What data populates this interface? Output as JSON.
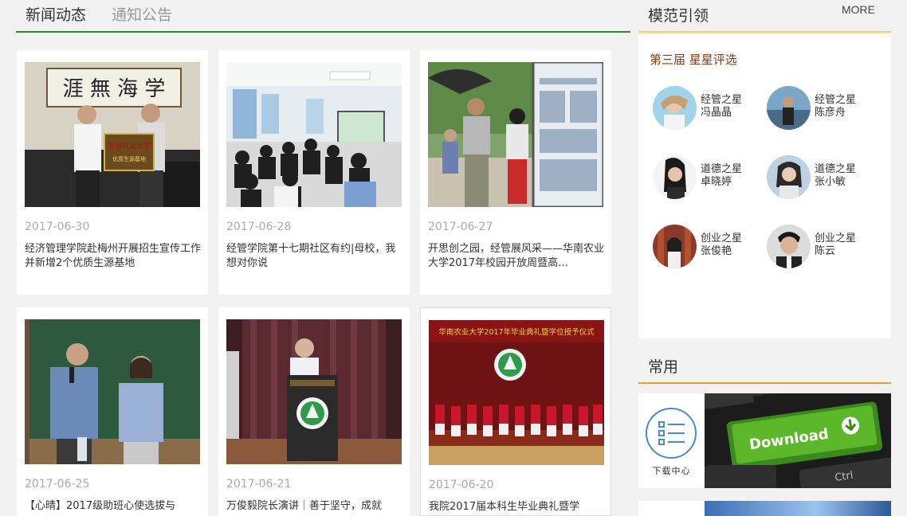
{
  "tabs": [
    {
      "label": "新闻动态"
    },
    {
      "label": "通知公告"
    }
  ],
  "news": [
    {
      "date": "2017-06-30",
      "title": "经济管理学院赴梅州开展招生宣传工作并新增2个优质生源基地"
    },
    {
      "date": "2017-06-28",
      "title": "经管学院第十七期社区有约|母校，我想对你说"
    },
    {
      "date": "2017-06-27",
      "title": "开思创之园，经管展风采——华南农业大学2017年校园开放周暨高…"
    },
    {
      "date": "2017-06-25",
      "title": "【心晴】2017级助班心使选拔与"
    },
    {
      "date": "2017-06-21",
      "title": "万俊毅院长演讲｜善于坚守，成就"
    },
    {
      "date": "2017-06-20",
      "title": "我院2017届本科生毕业典礼暨学"
    }
  ],
  "sidebar": {
    "models_title": "模范引领",
    "more": "MORE",
    "subtitle": "第三届 星星评选",
    "stars": [
      {
        "category": "经管之星",
        "name": "冯晶晶"
      },
      {
        "category": "经管之星",
        "name": "陈彦舟"
      },
      {
        "category": "道德之星",
        "name": "卓晓婷"
      },
      {
        "category": "道德之星",
        "name": "张小敏"
      },
      {
        "category": "创业之星",
        "name": "张俊艳"
      },
      {
        "category": "创业之星",
        "name": "陈云"
      }
    ],
    "common_title": "常用",
    "download_label": "下载中心",
    "download_key_text": "Download",
    "ctrl_key_text": "Ctrl"
  },
  "photo_text": {
    "plaque": "华南农业大学",
    "plaque_sub": "优质生源基地",
    "banner": "华南农业大学2017年毕业典礼暨学位授予仪式"
  }
}
